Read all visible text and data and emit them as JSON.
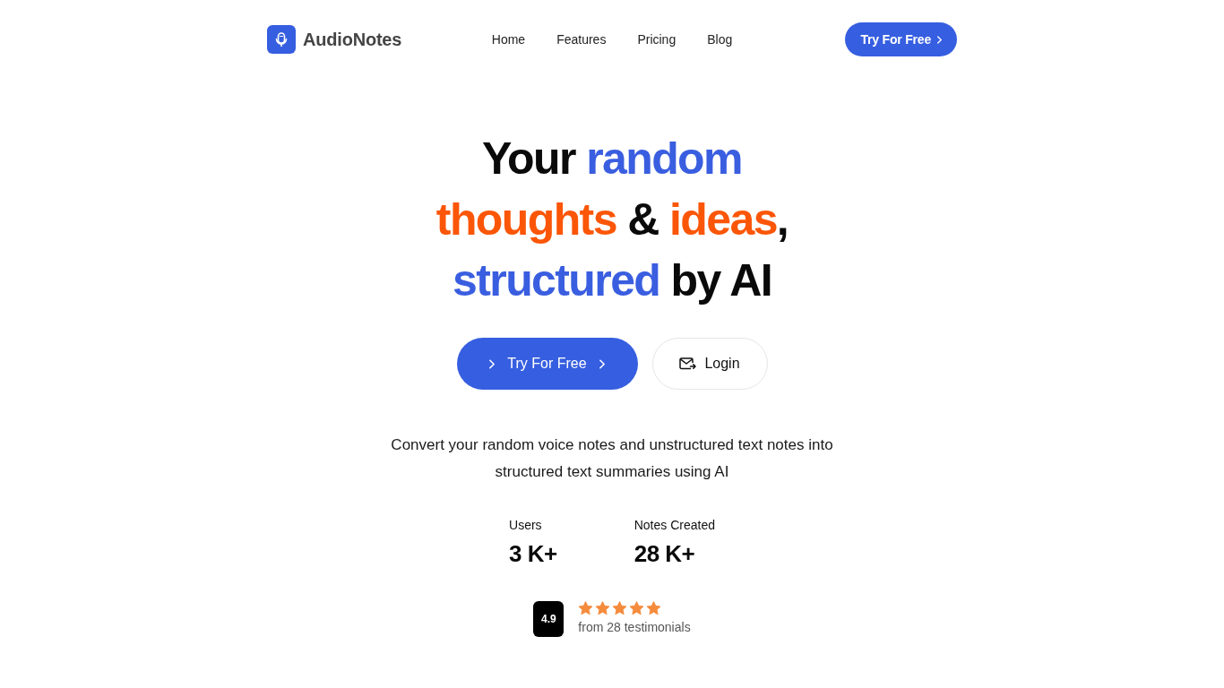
{
  "nav": {
    "brand": "AudioNotes",
    "links": [
      "Home",
      "Features",
      "Pricing",
      "Blog"
    ],
    "cta": "Try For Free"
  },
  "hero": {
    "headline": [
      [
        {
          "text": "Your ",
          "color": "#0a0a0a"
        },
        {
          "text": "random",
          "color": "#3a5ee0"
        }
      ],
      [
        {
          "text": "thoughts",
          "color": "#fb5607"
        },
        {
          "text": " & ",
          "color": "#0a0a0a"
        },
        {
          "text": "ideas",
          "color": "#fb5607"
        },
        {
          "text": ",",
          "color": "#0a0a0a"
        }
      ],
      [
        {
          "text": "structured",
          "color": "#3a5ee0"
        },
        {
          "text": " by AI",
          "color": "#0a0a0a"
        }
      ]
    ],
    "buttons": [
      {
        "kind": "primary",
        "label": "Try For Free"
      },
      {
        "kind": "secondary",
        "label": "Login"
      }
    ],
    "description": "Convert your random voice notes and unstructured text notes into structured text summaries using AI",
    "stats": [
      {
        "label": "Users",
        "value": "3 K+"
      },
      {
        "label": "Notes Created",
        "value": "28 K+"
      }
    ],
    "rating": {
      "score": "4.9",
      "stars": 5,
      "caption": "from 28 testimonials"
    }
  }
}
